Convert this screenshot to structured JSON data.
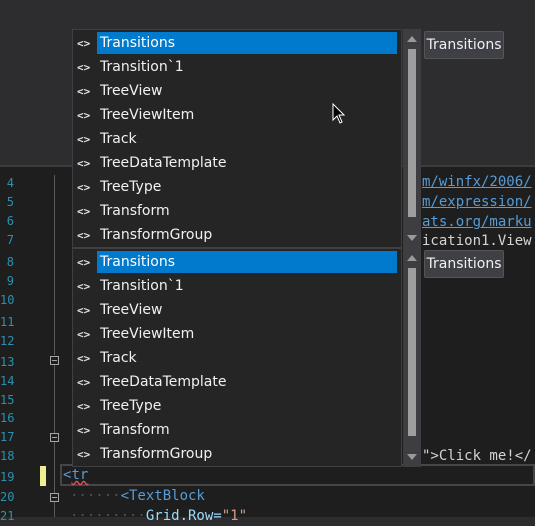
{
  "editor": {
    "line_numbers": [
      "4",
      "5",
      "6",
      "7",
      "8",
      "9",
      "10",
      "11",
      "12",
      "13",
      "14",
      "15",
      "16",
      "17",
      "18",
      "19",
      "20",
      "21"
    ],
    "code_lines": {
      "line4": "m/winfx/2006/",
      "line5": "m/expression/",
      "line6": "ats.org/marku",
      "line7": "ication1.View",
      "line17": "\">Click me!</",
      "line19_prefix": "<",
      "line19_typed": "tr",
      "line20_tag": "<TextBlock",
      "line21_attr": "Grid.Row=",
      "line21_val": "\"1\""
    }
  },
  "intellisense": {
    "tooltip_label": "Transitions",
    "items": [
      {
        "label": "Transitions",
        "icon": "<>"
      },
      {
        "label": "Transition`1",
        "icon": "<>"
      },
      {
        "label": "TreeView",
        "icon": "<>"
      },
      {
        "label": "TreeViewItem",
        "icon": "<>"
      },
      {
        "label": "Track",
        "icon": "<>"
      },
      {
        "label": "TreeDataTemplate",
        "icon": "<>"
      },
      {
        "label": "TreeType",
        "icon": "<>"
      },
      {
        "label": "Transform",
        "icon": "<>"
      },
      {
        "label": "TransformGroup",
        "icon": "<>"
      }
    ],
    "selected_index": 0
  },
  "colors": {
    "selection": "#007acc",
    "popup_bg": "#252526",
    "link": "#569cd6",
    "line_number": "#2b91af"
  }
}
